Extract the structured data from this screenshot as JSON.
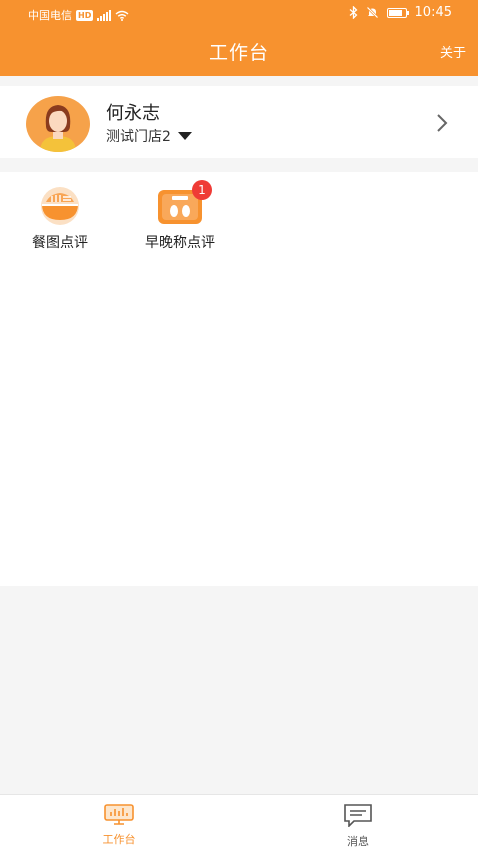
{
  "status": {
    "carrier": "中国电信",
    "network_badge": "HD",
    "time": "10:45",
    "battery_level": 0.8
  },
  "header": {
    "title": "工作台",
    "about_label": "关于"
  },
  "profile": {
    "name": "何永志",
    "store": "测试门店2"
  },
  "tools": [
    {
      "label": "餐图点评",
      "icon": "meal-review-icon"
    },
    {
      "label": "早晚称点评",
      "icon": "scale-review-icon",
      "badge": "1"
    }
  ],
  "tabs": [
    {
      "label": "工作台",
      "icon": "workbench-icon",
      "active": true
    },
    {
      "label": "消息",
      "icon": "message-icon",
      "active": false
    }
  ],
  "colors": {
    "brand": "#f7922f",
    "badge": "#ef3b36",
    "tab_inactive": "#555555"
  }
}
